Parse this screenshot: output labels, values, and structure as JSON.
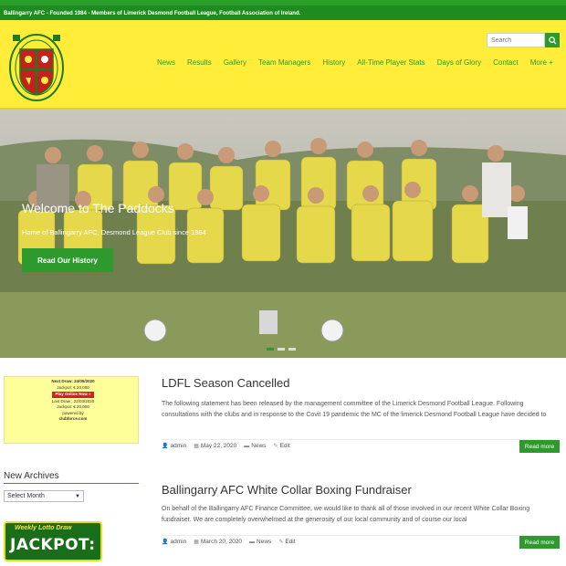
{
  "topbar": {
    "text": "Ballingarry AFC - Founded 1984 - Members of Limerick Desmond Football League, Football Association of Ireland."
  },
  "colors": {
    "brand_green": "#2e9a2e",
    "header_yellow": "#ffed3a",
    "topbar_green": "#1f8a1f"
  },
  "header": {
    "logo_alt": "Ballingarry A.F.C. crest",
    "search": {
      "placeholder": "Search",
      "icon": "search-icon"
    },
    "nav": [
      {
        "label": "News",
        "active": true
      },
      {
        "label": "Results"
      },
      {
        "label": "Gallery"
      },
      {
        "label": "Team Managers"
      },
      {
        "label": "History"
      },
      {
        "label": "All-Time Player Stats"
      },
      {
        "label": "Days of Glory"
      },
      {
        "label": "Contact"
      },
      {
        "label": "More +"
      }
    ]
  },
  "hero": {
    "title": "Welcome to The Paddocks",
    "subtitle": "Home of Ballingarry AFC, Desmond League Club since 1984",
    "button": "Read Our History",
    "slides": 3,
    "active_slide": 1
  },
  "sidebar": {
    "ad": {
      "next_draw": "Next Draw: 24/05/2020",
      "jackpot_next": "Jackpot: € 20,000",
      "play_button": "Play Online Now »",
      "last_draw": "Last Draw : 22/03/2020",
      "jackpot_last": "Jackpot: € 20,000",
      "powered_by": "powered by",
      "brand": "clubforce.com"
    },
    "archives": {
      "title": "New Archives",
      "select_value": "Select Month"
    },
    "jackpot_banner": {
      "small": "Weekly Lotto Draw",
      "big": "JACKPOT:"
    }
  },
  "posts": [
    {
      "title": "LDFL Season Cancelled",
      "excerpt": "The following statement has been released by the management committee of the Limerick Desmond Football League. Following consultations with the clubs and in response to the Covit 19 pandemic the MC of the limerick Desmond Football League have decided to",
      "author": "admin",
      "date": "May 22, 2020",
      "category": "News",
      "edit": "Edit",
      "read_more": "Read more"
    },
    {
      "title": "Ballingarry AFC White Collar Boxing Fundraiser",
      "excerpt": "On behalf of the Ballingarry AFC Finance Committee, we would like to thank all of those involved in our recent White Collar Boxing fundraiser. We are completely overwhelmed at the generosity of our local community and of course our local",
      "author": "admin",
      "date": "March 20, 2020",
      "category": "News",
      "edit": "Edit",
      "read_more": "Read more"
    }
  ]
}
